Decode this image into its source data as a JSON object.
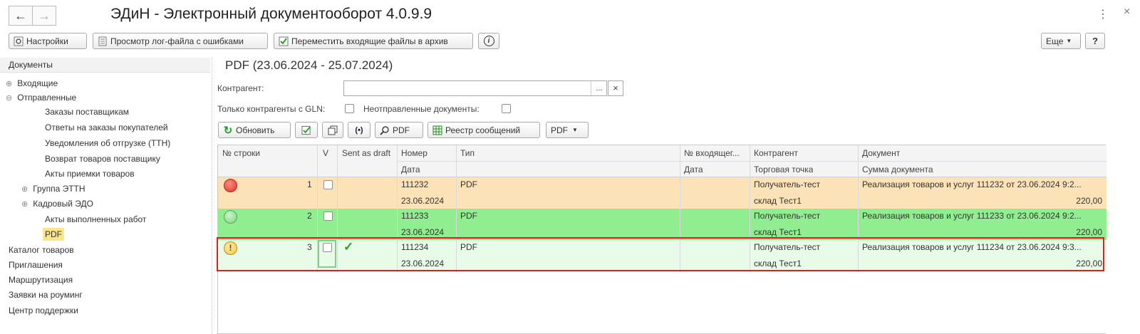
{
  "window": {
    "title": "ЭДиН - Электронный документооборот 4.0.9.9",
    "more_icon": "⋮",
    "close_icon": "×"
  },
  "toolbar": {
    "settings_label": "Настройки",
    "view_log_label": "Просмотр лог-файла с ошибками",
    "move_archive_label": "Переместить входящие файлы в архив",
    "more_label": "Еще",
    "help_label": "?"
  },
  "sidebar": {
    "header": "Документы",
    "items": [
      {
        "label": "Входящие"
      },
      {
        "label": "Отправленные"
      },
      {
        "label": "Заказы поставщикам"
      },
      {
        "label": "Ответы на заказы покупателей"
      },
      {
        "label": "Уведомления об отгрузке (ТТН)"
      },
      {
        "label": "Возврат товаров поставщику"
      },
      {
        "label": "Акты приемки товаров"
      },
      {
        "label": "Группа ЭТТН"
      },
      {
        "label": "Кадровый ЭДО"
      },
      {
        "label": "Акты выполненных работ"
      },
      {
        "label": "PDF"
      },
      {
        "label": "Каталог товаров"
      },
      {
        "label": "Приглашения"
      },
      {
        "label": "Маршрутизация"
      },
      {
        "label": "Заявки на роуминг"
      },
      {
        "label": "Центр поддержки"
      }
    ]
  },
  "form": {
    "title": "PDF (23.06.2024 - 25.07.2024)",
    "counterparty_label": "Контрагент:",
    "counterparty_value": "",
    "gln_only_label": "Только контрагенты с GLN:",
    "unsent_label": "Неотправленные документы:",
    "refresh_label": "Обновить",
    "pdf_label": "PDF",
    "registry_label": "Реестр сообщений",
    "pdf_menu_label": "PDF"
  },
  "table": {
    "headers": {
      "row_no": "№ строки",
      "v": "V",
      "sent_as_draft": "Sent as draft",
      "number": "Номер",
      "date": "Дата",
      "type": "Тип",
      "incoming_no": "№ входящег...",
      "incoming_date": "Дата",
      "counterparty": "Контрагент",
      "outlet": "Торговая точка",
      "document": "Документ",
      "doc_sum": "Сумма документа"
    },
    "rows": [
      {
        "n": "1",
        "number": "111232",
        "date": "23.06.2024",
        "type": "PDF",
        "counterparty": "Получатель-тест",
        "outlet": "склад Тест1",
        "document": "Реализация товаров и услуг 111232 от 23.06.2024 9:2...",
        "sum": "220,00",
        "draft": ""
      },
      {
        "n": "2",
        "number": "111233",
        "date": "23.06.2024",
        "type": "PDF",
        "counterparty": "Получатель-тест",
        "outlet": "склад Тест1",
        "document": "Реализация товаров и услуг 111233 от 23.06.2024 9:2...",
        "sum": "220,00",
        "draft": ""
      },
      {
        "n": "3",
        "number": "111234",
        "date": "23.06.2024",
        "type": "PDF",
        "counterparty": "Получатель-тест",
        "outlet": "склад Тест1",
        "document": "Реализация товаров и услуг 111234 от 23.06.2024 9:3...",
        "sum": "220,00",
        "draft": "✓"
      }
    ]
  },
  "colors": {
    "row1_bg": "#fce3b7",
    "row2_bg": "#90ee90",
    "row3_bg": "#e8fae8",
    "highlight_border": "#e02020",
    "status_red": "#e8453c",
    "status_green": "#7fd37f",
    "status_warning": "#f2c94c",
    "selected_tree_bg": "#fbe48a"
  }
}
